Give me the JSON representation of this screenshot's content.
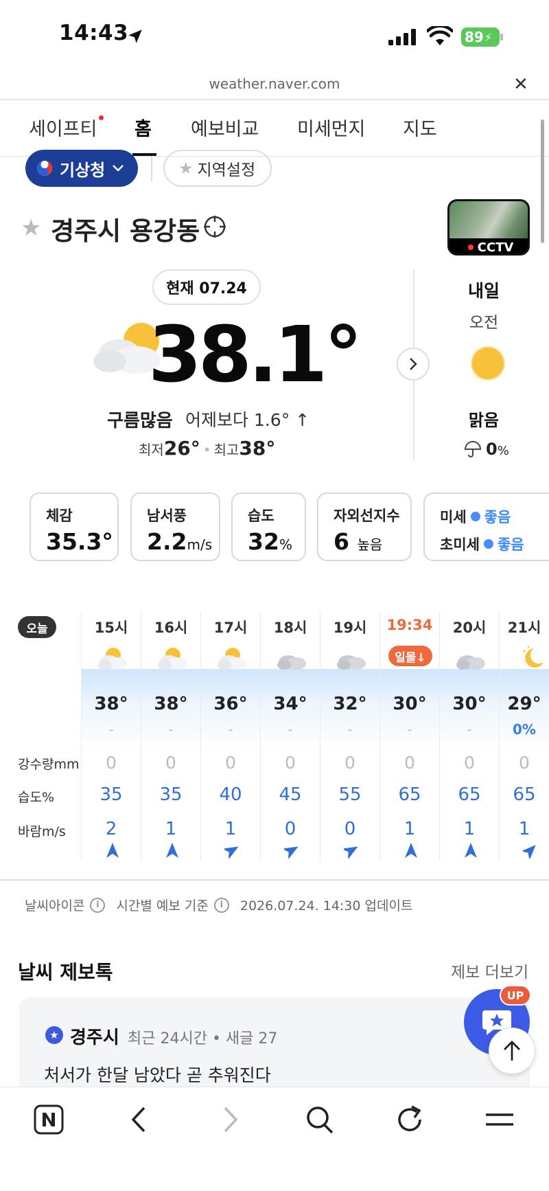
{
  "status": {
    "time": "14:43",
    "battery": "89"
  },
  "browser": {
    "url": "weather.naver.com"
  },
  "tabs": [
    {
      "label": "세이프티"
    },
    {
      "label": "홈"
    },
    {
      "label": "예보비교"
    },
    {
      "label": "미세먼지"
    },
    {
      "label": "지도"
    }
  ],
  "pills": {
    "kma": "기상청",
    "region": "지역설정"
  },
  "location": {
    "name": "경주시 용강동"
  },
  "cctv": {
    "label": "CCTV"
  },
  "current": {
    "date": "현재 07.24",
    "temp": "38.1°",
    "condition": "구름많음",
    "compare": "어제보다 1.6° ↑",
    "min_label": "최저",
    "min": "26°",
    "max_label": "최고",
    "max": "38°"
  },
  "tomorrow": {
    "title": "내일",
    "period": "오전",
    "condition": "맑음",
    "rain": "0",
    "rain_unit": "%"
  },
  "cards": {
    "feel": {
      "label": "체감",
      "value": "35.3°"
    },
    "wind": {
      "label": "남서풍",
      "value": "2.2",
      "unit": "m/s"
    },
    "humidity": {
      "label": "습도",
      "value": "32",
      "unit": "%"
    },
    "uv": {
      "label": "자외선지수",
      "value": "6",
      "level": "높음"
    },
    "dust": {
      "pm10_label": "미세",
      "pm10": "좋음",
      "pm25_label": "초미세",
      "pm25": "좋음"
    }
  },
  "hourly": {
    "today": "오늘",
    "labels": {
      "rain": "강수량mm",
      "humidity": "습도%",
      "wind": "바람m/s"
    },
    "hours": [
      {
        "time": "15시",
        "icon": "partly-cloudy-icon",
        "temp": "38°",
        "pop": "-",
        "rain": "0",
        "hum": "35",
        "wind": "2",
        "dir": 0
      },
      {
        "time": "16시",
        "icon": "partly-cloudy-icon",
        "temp": "38°",
        "pop": "-",
        "rain": "0",
        "hum": "35",
        "wind": "1",
        "dir": 0
      },
      {
        "time": "17시",
        "icon": "partly-cloudy-icon",
        "temp": "36°",
        "pop": "-",
        "rain": "0",
        "hum": "40",
        "wind": "1",
        "dir": 60
      },
      {
        "time": "18시",
        "icon": "cloudy-icon",
        "temp": "34°",
        "pop": "-",
        "rain": "0",
        "hum": "45",
        "wind": "0",
        "dir": 60
      },
      {
        "time": "19시",
        "icon": "cloudy-icon",
        "temp": "32°",
        "pop": "-",
        "rain": "0",
        "hum": "55",
        "wind": "0",
        "dir": 60
      },
      {
        "time": "19:34",
        "icon": "sunset-badge",
        "badge": "일몰↓",
        "temp": "30°",
        "pop": "-",
        "rain": "0",
        "hum": "65",
        "wind": "1",
        "dir": 0
      },
      {
        "time": "20시",
        "icon": "cloudy-icon",
        "temp": "30°",
        "pop": "-",
        "rain": "0",
        "hum": "65",
        "wind": "1",
        "dir": 0
      },
      {
        "time": "21시",
        "icon": "moon-icon",
        "temp": "29°",
        "pop": "0%",
        "rain": "0",
        "hum": "65",
        "wind": "1",
        "dir": 45
      }
    ]
  },
  "info": {
    "icon_label": "날씨아이콘",
    "basis_label": "시간별 예보 기준",
    "updated": "2026.07.24. 14:30 업데이트"
  },
  "report": {
    "title": "날씨 제보톡",
    "more": "제보 더보기",
    "city": "경주시",
    "meta": "최근 24시간 • 새글 27",
    "text": "처서가 한달 남았다 곧 추워진다",
    "up_badge": "UP"
  },
  "colors": {
    "accent_blue": "#1d3e96",
    "sunset": "#ee6a3c",
    "value_blue": "#2f6fd6"
  }
}
